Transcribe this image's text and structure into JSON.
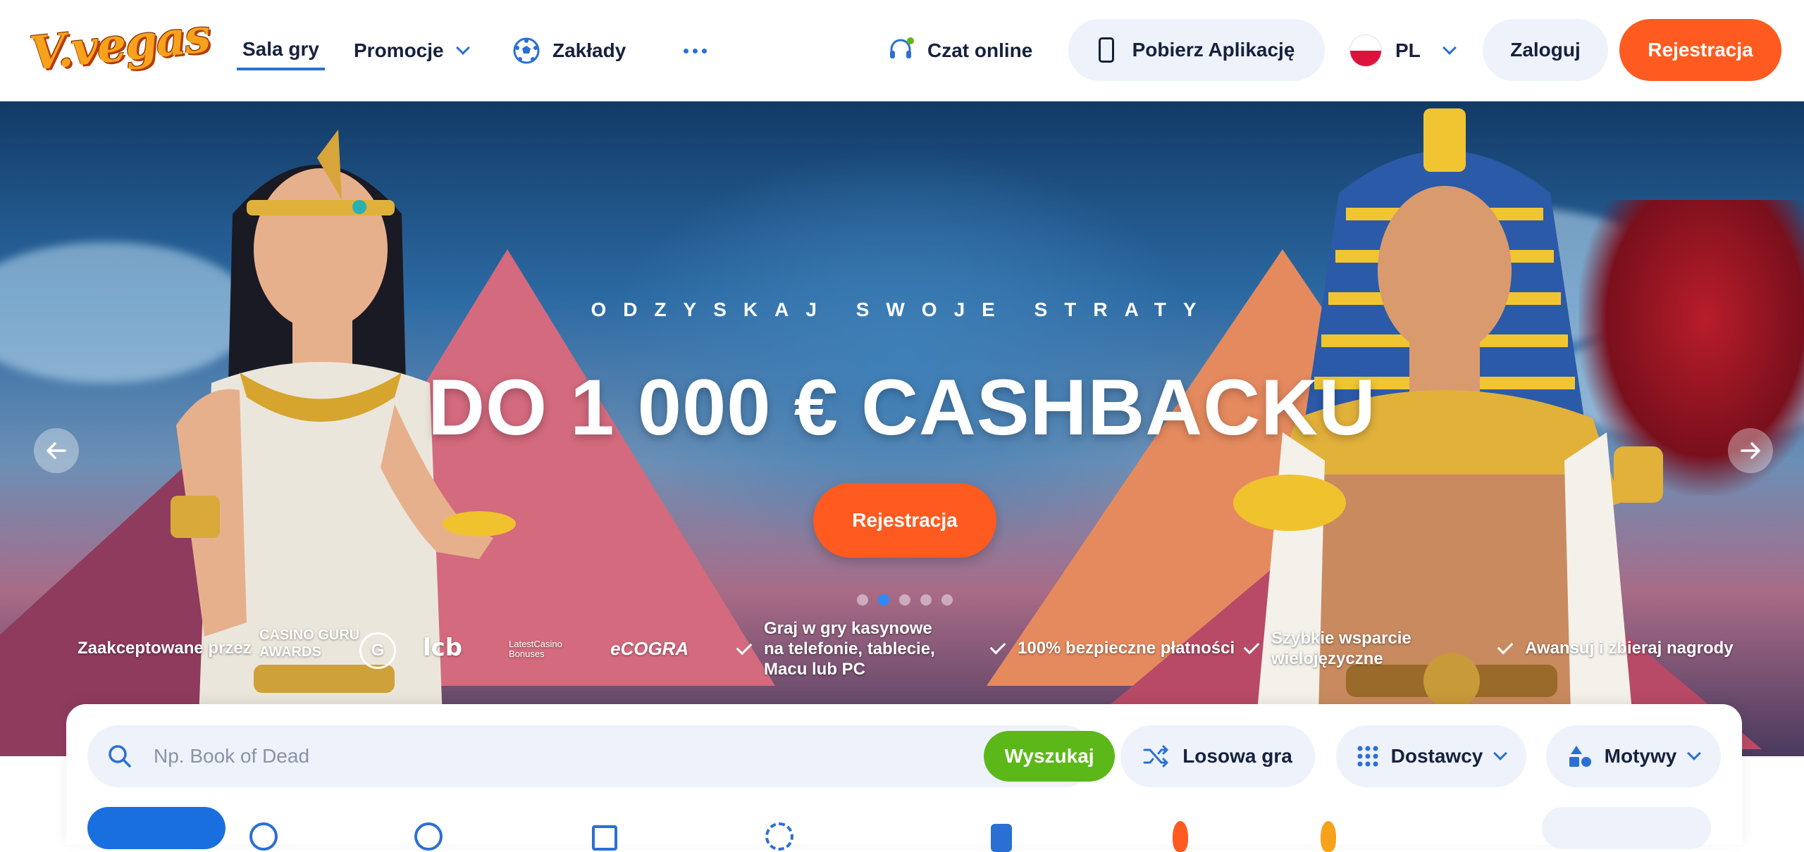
{
  "header": {
    "logo_text": "V.vegas",
    "nav": [
      {
        "label": "Sala gry",
        "active": true
      },
      {
        "label": "Promocje",
        "active": false
      },
      {
        "label": "Zakłady",
        "active": false
      }
    ],
    "chat_label": "Czat online",
    "app_label": "Pobierz Aplikację",
    "language": "PL",
    "login_label": "Zaloguj",
    "register_label": "Rejestracja"
  },
  "hero": {
    "subtitle": "ODZYSKAJ SWOJE STRATY",
    "title": "DO 1 000 € CASHBACKU",
    "cta_label": "Rejestracja",
    "slide_count": 5,
    "active_slide": 2
  },
  "trust": {
    "accepted_label": "Zaakceptowane przez",
    "awards": [
      "CASINO GURU AWARDS",
      "lcb",
      "LatestCasino Bonuses",
      "eCOGRA"
    ],
    "features": [
      "Graj w gry kasynowe na telefonie, tablecie, Macu lub PC",
      "100% bezpieczne płatności",
      "Szybkie wsparcie wielojęzyczne",
      "Awansuj i zbieraj nagrody"
    ]
  },
  "search": {
    "placeholder": "Np. Book of Dead",
    "button_label": "Wyszukaj",
    "random_label": "Losowa gra",
    "providers_label": "Dostawcy",
    "themes_label": "Motywy"
  },
  "colors": {
    "accent_orange": "#ff5a1f",
    "accent_blue": "#2b6fd4",
    "search_green": "#5cb818",
    "light_pill": "#eef2fa",
    "text_dark": "#16213e"
  }
}
